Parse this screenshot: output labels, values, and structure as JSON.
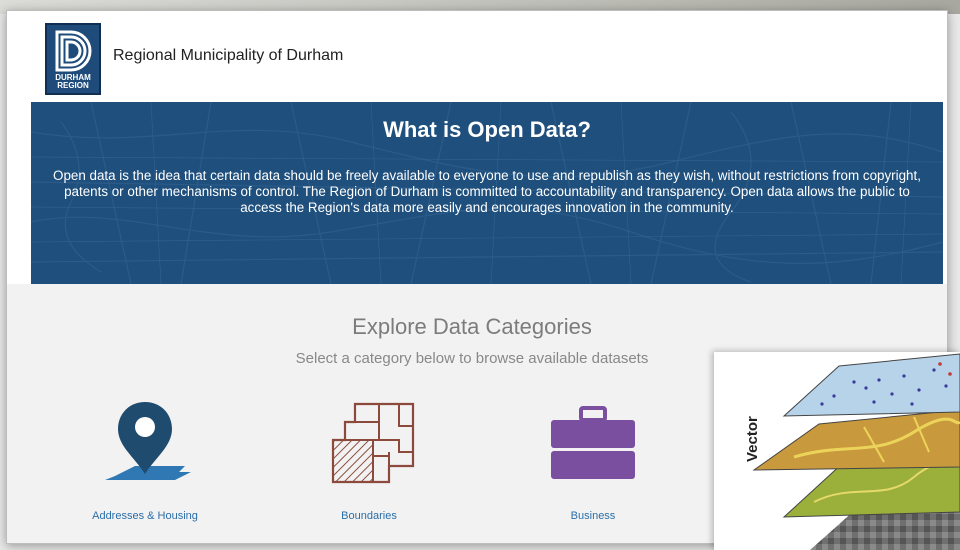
{
  "header": {
    "logo_text": [
      "DURHAM",
      "REGION"
    ],
    "org_name": "Regional Municipality of Durham"
  },
  "banner": {
    "title": "What is Open Data?",
    "text": "Open data is the idea that certain data should be freely available to everyone to use and republish as they wish, without restrictions from copyright, patents or other mechanisms of control. The Region of Durham is committed to accountability and transparency. Open data allows the public to access the Region's data more easily and encourages innovation in the community."
  },
  "explore": {
    "title": "Explore Data Categories",
    "subtitle": "Select a category below to browse available datasets",
    "categories": [
      {
        "label": "Addresses & Housing",
        "icon": "map-pin-icon",
        "color": "#1f4b6e"
      },
      {
        "label": "Boundaries",
        "icon": "boundaries-icon",
        "color": "#8b4a3c"
      },
      {
        "label": "Business",
        "icon": "briefcase-icon",
        "color": "#7a4fa0"
      }
    ]
  },
  "vector_panel": {
    "label": "Vector",
    "icon": "gis-layers-icon"
  },
  "colors": {
    "banner_bg": "#1f4f7c",
    "link": "#2a6ea8"
  }
}
